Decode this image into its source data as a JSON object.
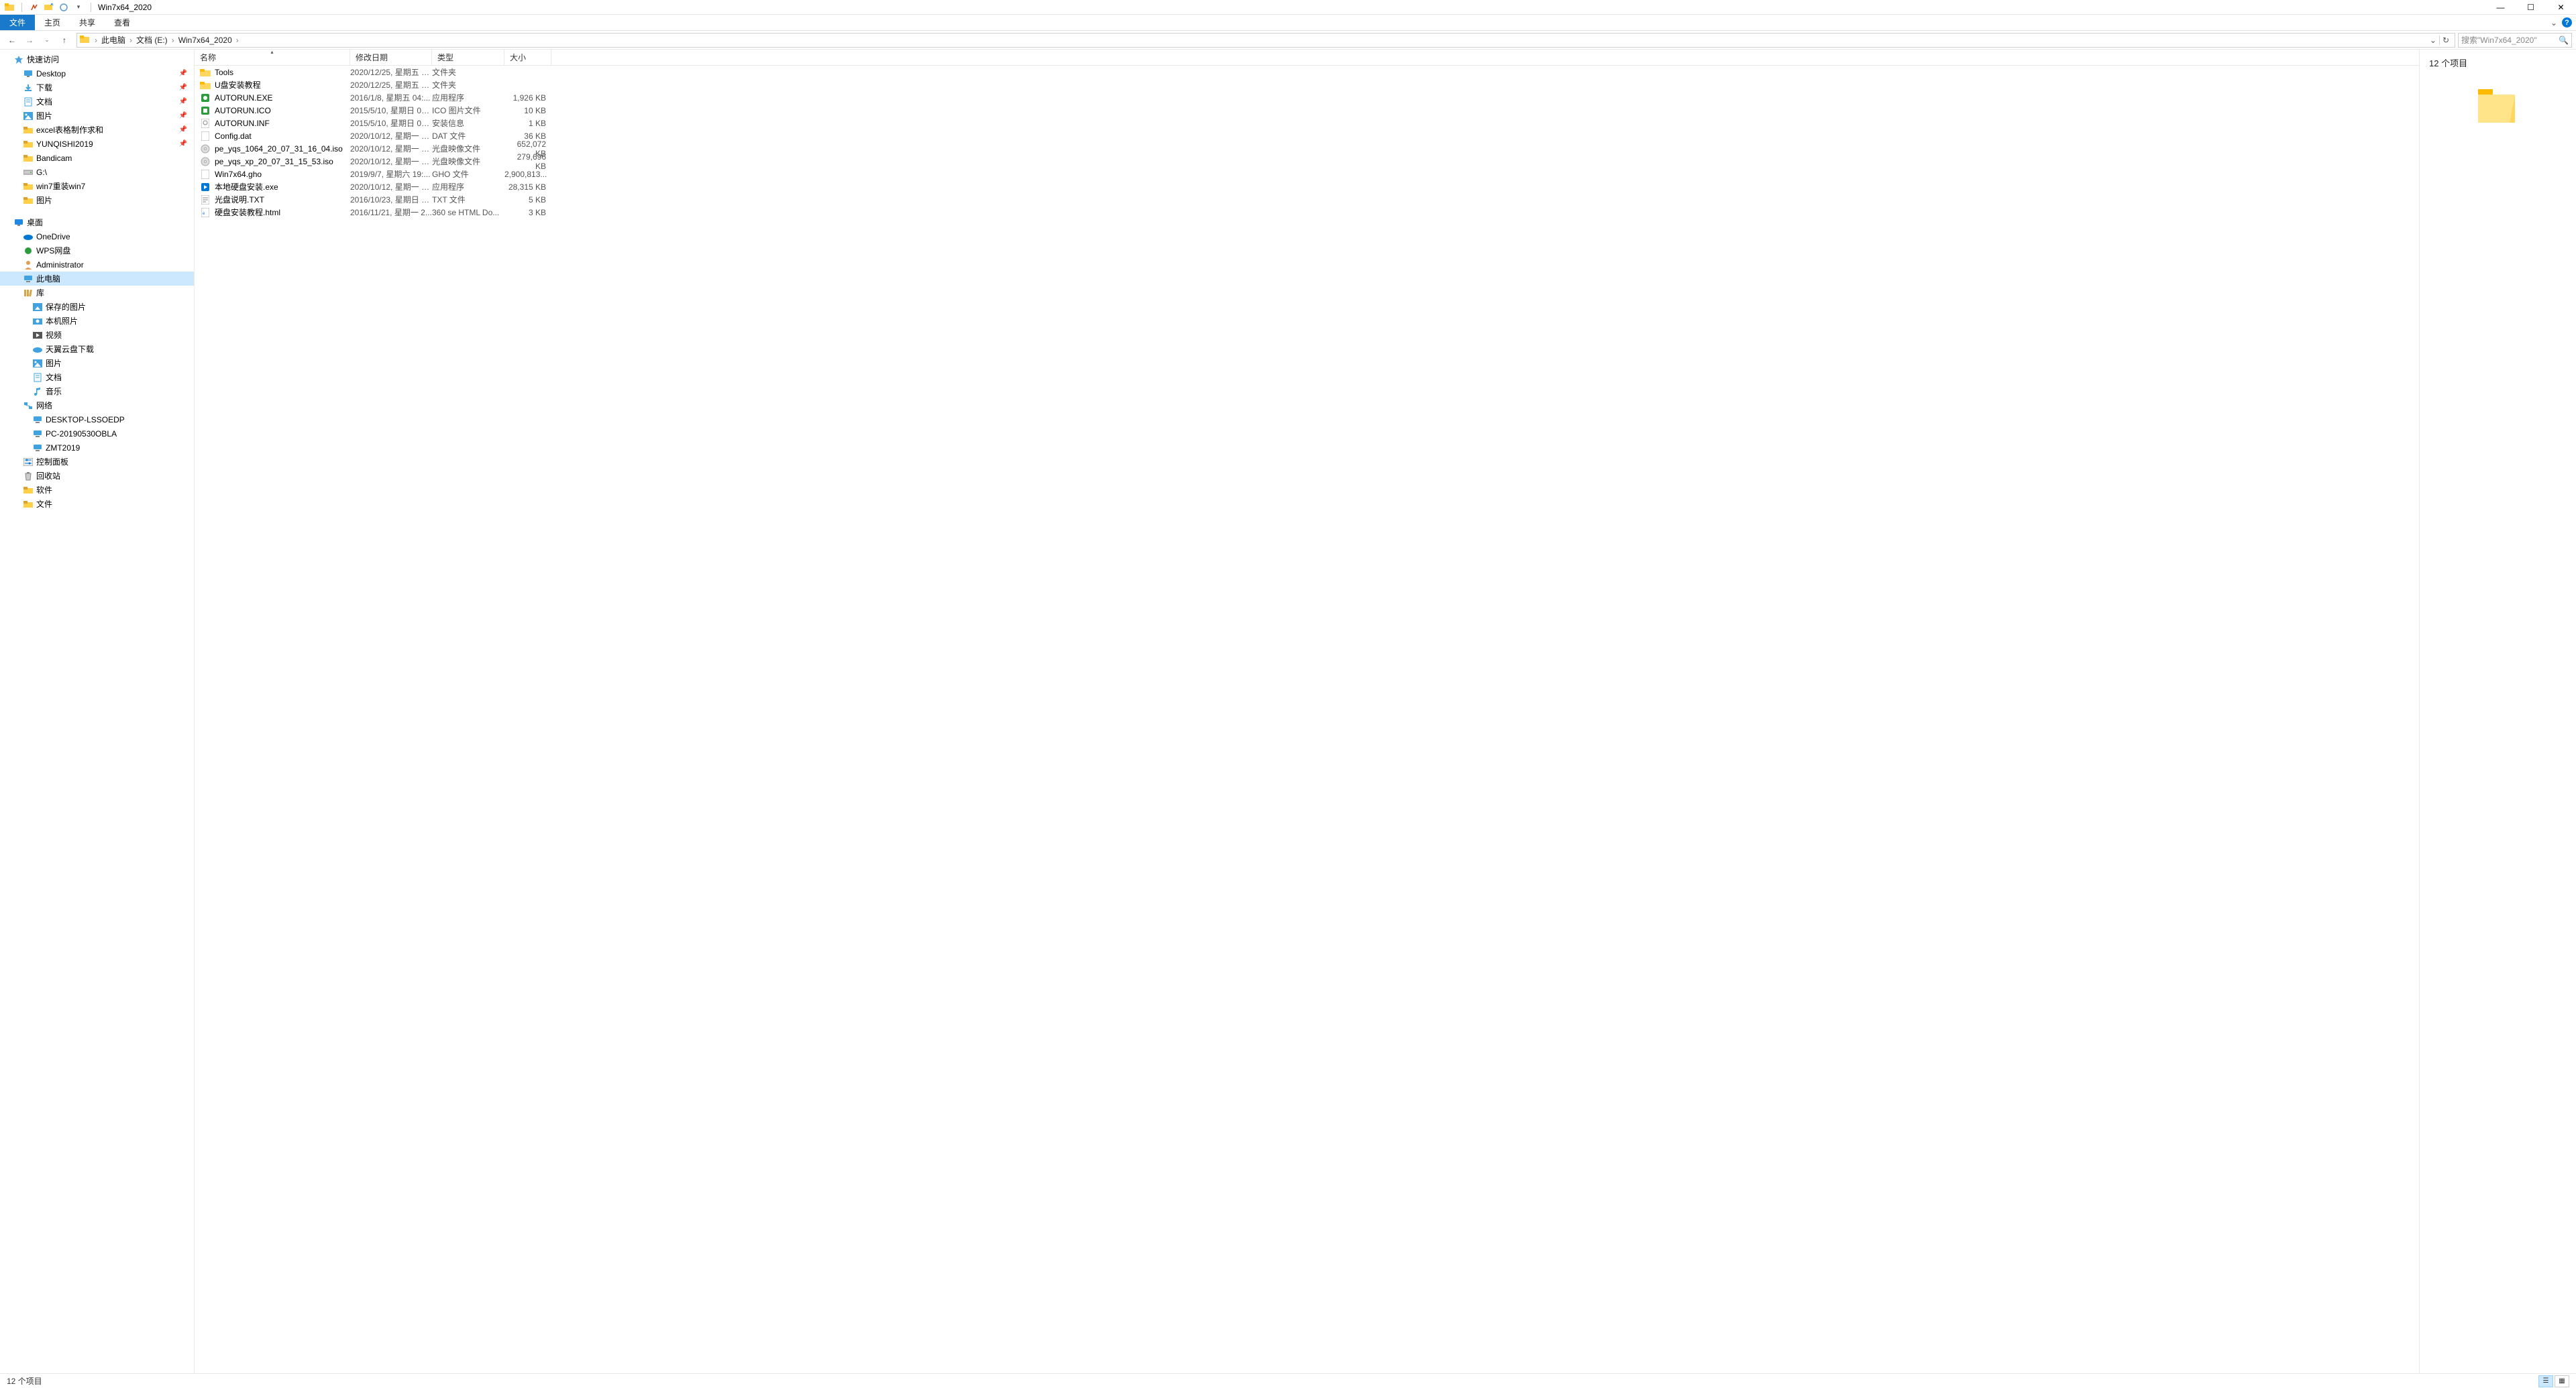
{
  "window": {
    "title": "Win7x64_2020",
    "minimize": "—",
    "maximize": "☐",
    "close": "✕"
  },
  "ribbon": {
    "file": "文件",
    "home": "主页",
    "share": "共享",
    "view": "查看",
    "expand": "⌄",
    "help": "?"
  },
  "nav": {
    "back": "←",
    "forward": "→",
    "recent": "⌄",
    "up": "↑"
  },
  "breadcrumbs": [
    {
      "label": "此电脑"
    },
    {
      "label": "文档 (E:)"
    },
    {
      "label": "Win7x64_2020"
    }
  ],
  "address_dropdown": "⌄",
  "address_refresh": "↻",
  "search": {
    "placeholder": "搜索\"Win7x64_2020\"",
    "icon": "🔍"
  },
  "sidebar": [
    {
      "indent": 1,
      "icon": "star",
      "label": "快速访问",
      "color": "#4aa3df",
      "spacer_before": false
    },
    {
      "indent": 2,
      "icon": "desktop",
      "label": "Desktop",
      "color": "#40a3e0",
      "pinned": true
    },
    {
      "indent": 2,
      "icon": "download",
      "label": "下载",
      "color": "#40a3e0",
      "pinned": true
    },
    {
      "indent": 2,
      "icon": "doc",
      "label": "文档",
      "color": "#40a3e0",
      "pinned": true
    },
    {
      "indent": 2,
      "icon": "pic",
      "label": "图片",
      "color": "#40a3e0",
      "pinned": true
    },
    {
      "indent": 2,
      "icon": "folder",
      "label": "excel表格制作求和",
      "color": "#ffcf48",
      "pinned": true
    },
    {
      "indent": 2,
      "icon": "folder",
      "label": "YUNQISHI2019",
      "color": "#ffcf48",
      "pinned": true
    },
    {
      "indent": 2,
      "icon": "folder",
      "label": "Bandicam",
      "color": "#ffcf48"
    },
    {
      "indent": 2,
      "icon": "drive",
      "label": "G:\\",
      "color": "#888"
    },
    {
      "indent": 2,
      "icon": "folder",
      "label": "win7重装win7",
      "color": "#ffcf48"
    },
    {
      "indent": 2,
      "icon": "folder",
      "label": "图片",
      "color": "#ffcf48"
    },
    {
      "indent": 1,
      "icon": "desktop",
      "label": "桌面",
      "color": "#1e88e5",
      "spacer_before": true
    },
    {
      "indent": 2,
      "icon": "onedrive",
      "label": "OneDrive",
      "color": "#0078d4"
    },
    {
      "indent": 2,
      "icon": "wps",
      "label": "WPS网盘",
      "color": "#2a9d3a"
    },
    {
      "indent": 2,
      "icon": "user",
      "label": "Administrator",
      "color": "#e0a050"
    },
    {
      "indent": 2,
      "icon": "pc",
      "label": "此电脑",
      "color": "#40a3e0",
      "selected": true
    },
    {
      "indent": 2,
      "icon": "lib",
      "label": "库",
      "color": "#d4a84a"
    },
    {
      "indent": 3,
      "icon": "savedpic",
      "label": "保存的图片",
      "color": "#40a3e0"
    },
    {
      "indent": 3,
      "icon": "camroll",
      "label": "本机照片",
      "color": "#40a3e0"
    },
    {
      "indent": 3,
      "icon": "video",
      "label": "视频",
      "color": "#555"
    },
    {
      "indent": 3,
      "icon": "cloud",
      "label": "天翼云盘下载",
      "color": "#40a3e0"
    },
    {
      "indent": 3,
      "icon": "pic",
      "label": "图片",
      "color": "#40a3e0"
    },
    {
      "indent": 3,
      "icon": "doc",
      "label": "文档",
      "color": "#40a3e0"
    },
    {
      "indent": 3,
      "icon": "music",
      "label": "音乐",
      "color": "#40a3e0"
    },
    {
      "indent": 2,
      "icon": "network",
      "label": "网络",
      "color": "#40a3e0"
    },
    {
      "indent": 3,
      "icon": "pc",
      "label": "DESKTOP-LSSOEDP",
      "color": "#40a3e0"
    },
    {
      "indent": 3,
      "icon": "pc",
      "label": "PC-20190530OBLA",
      "color": "#40a3e0"
    },
    {
      "indent": 3,
      "icon": "pc",
      "label": "ZMT2019",
      "color": "#40a3e0"
    },
    {
      "indent": 2,
      "icon": "cpanel",
      "label": "控制面板",
      "color": "#555"
    },
    {
      "indent": 2,
      "icon": "recycle",
      "label": "回收站",
      "color": "#555"
    },
    {
      "indent": 2,
      "icon": "folder",
      "label": "软件",
      "color": "#ffcf48"
    },
    {
      "indent": 2,
      "icon": "folder",
      "label": "文件",
      "color": "#ffcf48"
    }
  ],
  "columns": {
    "name": "名称",
    "date": "修改日期",
    "type": "类型",
    "size": "大小"
  },
  "files": [
    {
      "icon": "folder",
      "name": "Tools",
      "date": "2020/12/25, 星期五 1...",
      "type": "文件夹",
      "size": ""
    },
    {
      "icon": "folder",
      "name": "U盘安装教程",
      "date": "2020/12/25, 星期五 1...",
      "type": "文件夹",
      "size": ""
    },
    {
      "icon": "exe-green",
      "name": "AUTORUN.EXE",
      "date": "2016/1/8, 星期五 04:...",
      "type": "应用程序",
      "size": "1,926 KB"
    },
    {
      "icon": "ico-green",
      "name": "AUTORUN.ICO",
      "date": "2015/5/10, 星期日 02...",
      "type": "ICO 图片文件",
      "size": "10 KB"
    },
    {
      "icon": "inf",
      "name": "AUTORUN.INF",
      "date": "2015/5/10, 星期日 02...",
      "type": "安装信息",
      "size": "1 KB"
    },
    {
      "icon": "dat",
      "name": "Config.dat",
      "date": "2020/10/12, 星期一 1...",
      "type": "DAT 文件",
      "size": "36 KB"
    },
    {
      "icon": "iso",
      "name": "pe_yqs_1064_20_07_31_16_04.iso",
      "date": "2020/10/12, 星期一 1...",
      "type": "光盘映像文件",
      "size": "652,072 KB"
    },
    {
      "icon": "iso",
      "name": "pe_yqs_xp_20_07_31_15_53.iso",
      "date": "2020/10/12, 星期一 1...",
      "type": "光盘映像文件",
      "size": "279,696 KB"
    },
    {
      "icon": "gho",
      "name": "Win7x64.gho",
      "date": "2019/9/7, 星期六 19:...",
      "type": "GHO 文件",
      "size": "2,900,813..."
    },
    {
      "icon": "exe-blue",
      "name": "本地硬盘安装.exe",
      "date": "2020/10/12, 星期一 1...",
      "type": "应用程序",
      "size": "28,315 KB"
    },
    {
      "icon": "txt",
      "name": "光盘说明.TXT",
      "date": "2016/10/23, 星期日 0...",
      "type": "TXT 文件",
      "size": "5 KB"
    },
    {
      "icon": "html",
      "name": "硬盘安装教程.html",
      "date": "2016/11/21, 星期一 2...",
      "type": "360 se HTML Do...",
      "size": "3 KB"
    }
  ],
  "preview": {
    "title": "12 个项目"
  },
  "statusbar": {
    "text": "12 个项目"
  }
}
